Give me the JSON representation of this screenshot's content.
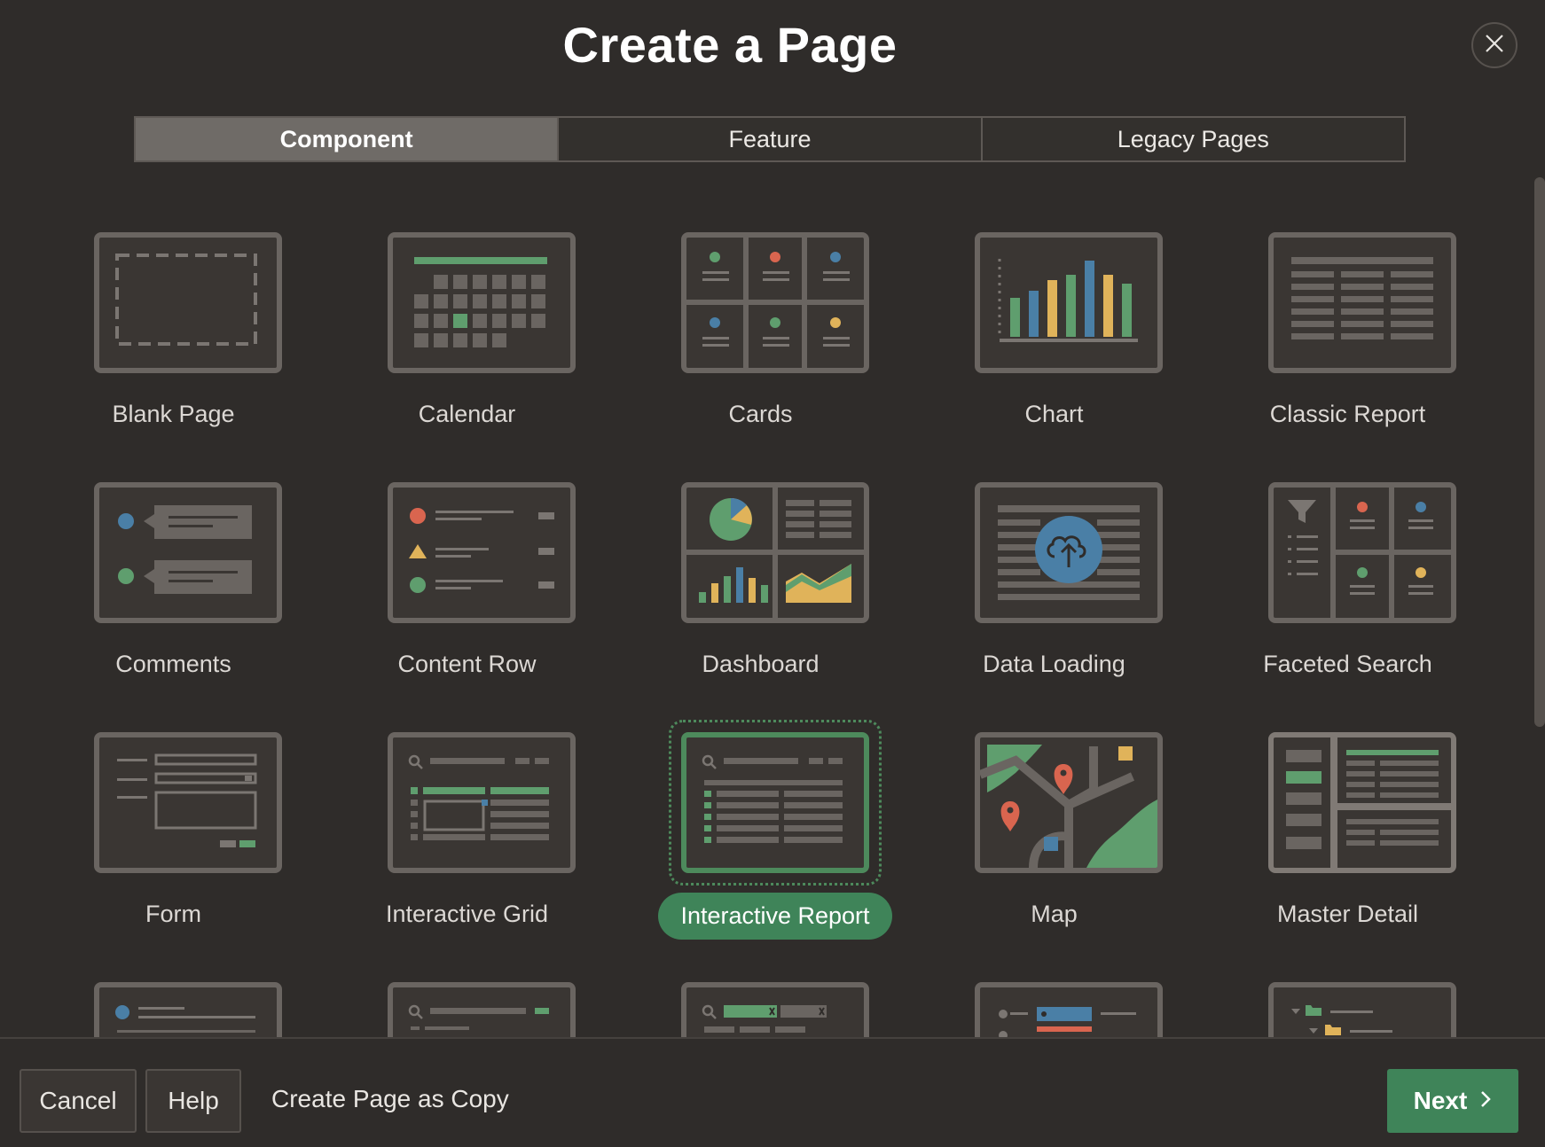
{
  "dialog": {
    "title": "Create a Page",
    "close_icon": "close-icon"
  },
  "tabs": [
    {
      "label": "Component",
      "active": true
    },
    {
      "label": "Feature",
      "active": false
    },
    {
      "label": "Legacy Pages",
      "active": false
    }
  ],
  "tiles": [
    {
      "label": "Blank Page",
      "icon": "blank-page-icon"
    },
    {
      "label": "Calendar",
      "icon": "calendar-icon"
    },
    {
      "label": "Cards",
      "icon": "cards-icon"
    },
    {
      "label": "Chart",
      "icon": "chart-icon"
    },
    {
      "label": "Classic Report",
      "icon": "classic-report-icon"
    },
    {
      "label": "Comments",
      "icon": "comments-icon"
    },
    {
      "label": "Content Row",
      "icon": "content-row-icon"
    },
    {
      "label": "Dashboard",
      "icon": "dashboard-icon"
    },
    {
      "label": "Data Loading",
      "icon": "data-loading-icon"
    },
    {
      "label": "Faceted Search",
      "icon": "faceted-search-icon"
    },
    {
      "label": "Form",
      "icon": "form-icon"
    },
    {
      "label": "Interactive Grid",
      "icon": "interactive-grid-icon"
    },
    {
      "label": "Interactive Report",
      "icon": "interactive-report-icon",
      "selected": true
    },
    {
      "label": "Map",
      "icon": "map-icon"
    },
    {
      "label": "Master Detail",
      "icon": "master-detail-icon"
    }
  ],
  "footer": {
    "cancel_label": "Cancel",
    "help_label": "Help",
    "copy_label": "Create Page as Copy",
    "next_label": "Next"
  },
  "colors": {
    "background": "#2f2c2a",
    "accent_green": "#3f8459",
    "tile_border": "#6a6561",
    "red": "#d9654f",
    "blue": "#4a7fa6",
    "yellow": "#e0b35a",
    "green": "#5f9e6e"
  }
}
